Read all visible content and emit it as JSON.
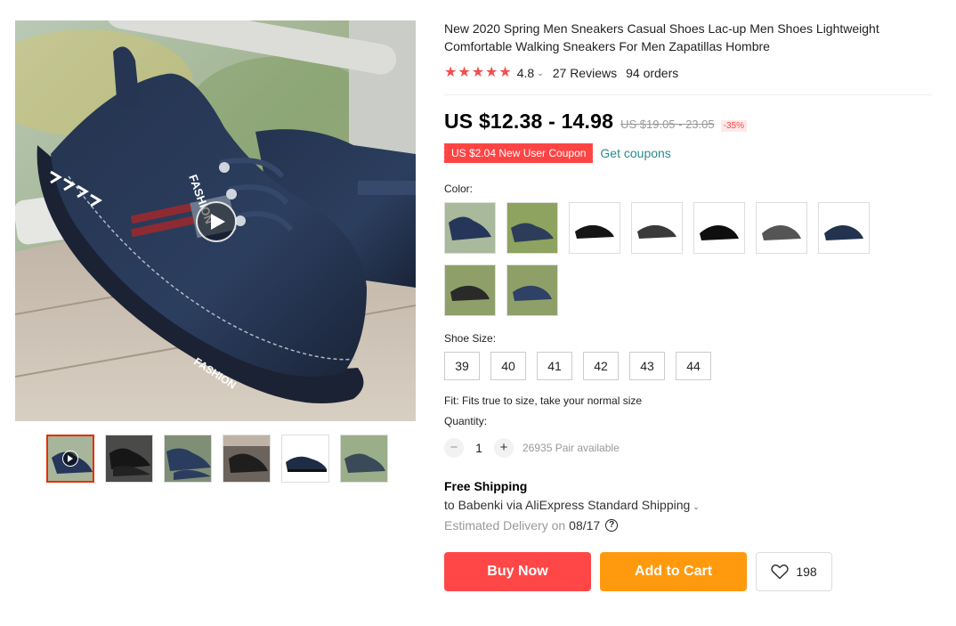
{
  "product": {
    "title": "New 2020 Spring Men Sneakers Casual Shoes Lac-up Men Shoes Lightweight Comfortable Walking Sneakers For Men Zapatillas Hombre",
    "rating": "4.8",
    "reviews": "27 Reviews",
    "orders": "94 orders"
  },
  "price": {
    "current": "US $12.38 - 14.98",
    "original": "US $19.05 - 23.05",
    "discount": "-35%"
  },
  "coupon": {
    "label": "US $2.04 New User Coupon",
    "link": "Get coupons"
  },
  "color": {
    "label": "Color:",
    "options": [
      "blue-canvas",
      "green-grass",
      "black-1",
      "black-2",
      "black-3",
      "grey",
      "navy",
      "grass-black",
      "grass-blue"
    ]
  },
  "size": {
    "label": "Shoe Size:",
    "options": [
      "39",
      "40",
      "41",
      "42",
      "43",
      "44"
    ]
  },
  "fit": "Fit: Fits true to size, take your normal size",
  "quantity": {
    "label": "Quantity:",
    "value": "1",
    "available": "26935 Pair available",
    "minus": "−",
    "plus": "+"
  },
  "shipping": {
    "title": "Free Shipping",
    "line": "to Babenki via AliExpress Standard Shipping",
    "caret": "⌄",
    "estimated": "Estimated Delivery on",
    "date": "08/17",
    "help": "?"
  },
  "actions": {
    "buy": "Buy Now",
    "cart": "Add to Cart",
    "wish_count": "198"
  },
  "main_image_text": {
    "shoe_side": "FASHION",
    "tongue": "FASHION"
  },
  "colors": {
    "buy": "#ff4747",
    "cart": "#ff9a0e",
    "star": "#f34d4d",
    "coupon": "#ff4444",
    "link": "#2a8a8a"
  }
}
